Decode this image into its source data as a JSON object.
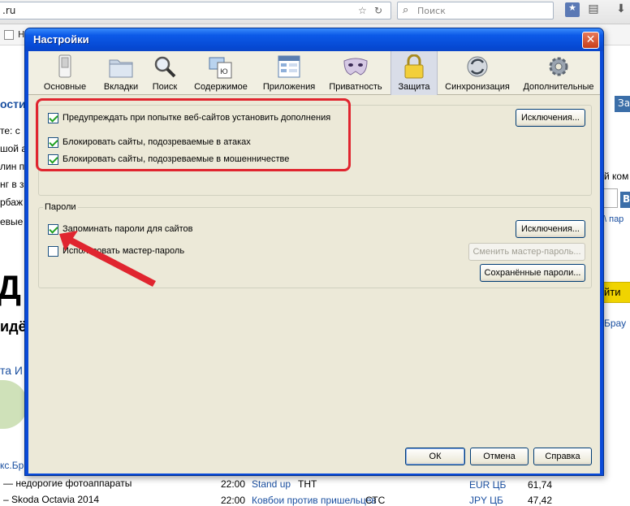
{
  "browser": {
    "url_fragment": ".ru",
    "search_placeholder": "Поиск",
    "bookmark_label": "Н"
  },
  "background_page": {
    "left_lines": [
      "ости",
      "те: с",
      "шой а",
      "лин п",
      "нг в з",
      "рбаж",
      "евые"
    ],
    "big_letter": "Д",
    "sub_text": "идёт",
    "link_text": "та И",
    "brand_link": "кс.Бр",
    "news_1": "— недорогие фотоаппараты",
    "news_2": "– Skoda Octavia 2014",
    "tv_time_1": "22:00",
    "tv_show_1": "Stand up",
    "tv_channel_1": "ТНТ",
    "tv_time_2": "22:00",
    "tv_show_2": "Ковбои против пришельцев",
    "tv_channel_2": "СТС",
    "currency_1": "EUR ЦБ",
    "rate_1": "61,74",
    "currency_2": "JPY ЦБ",
    "rate_2": "47,42",
    "right_tab": "За",
    "right_text_1": "й ком",
    "right_text_2": "\\ пар",
    "right_btn": "В",
    "right_find": "йти",
    "right_brau": "Брау"
  },
  "dialog": {
    "title": "Настройки",
    "categories": [
      {
        "label": "Основные",
        "icon": "switch-icon"
      },
      {
        "label": "Вкладки",
        "icon": "folder-tabs-icon"
      },
      {
        "label": "Поиск",
        "icon": "magnifier-icon"
      },
      {
        "label": "Содержимое",
        "icon": "content-icon"
      },
      {
        "label": "Приложения",
        "icon": "applications-icon"
      },
      {
        "label": "Приватность",
        "icon": "mask-icon"
      },
      {
        "label": "Защита",
        "icon": "padlock-icon",
        "selected": true
      },
      {
        "label": "Синхронизация",
        "icon": "sync-icon"
      },
      {
        "label": "Дополнительные",
        "icon": "gear-icon"
      }
    ],
    "security": {
      "warn_addons": {
        "label": "Предупреждать при попытке веб-сайтов установить дополнения",
        "checked": true
      },
      "exceptions_1": "Исключения...",
      "block_attack": {
        "label": "Блокировать сайты, подозреваемые в атаках",
        "checked": true
      },
      "block_forgery": {
        "label": "Блокировать сайты, подозреваемые в мошенничестве",
        "checked": true
      }
    },
    "passwords": {
      "group_title": "Пароли",
      "remember": {
        "label": "Запоминать пароли для сайтов",
        "checked": true
      },
      "exceptions_2": "Исключения...",
      "master": {
        "label": "Использовать мастер-пароль",
        "checked": false
      },
      "change_master": "Сменить мастер-пароль...",
      "saved_passwords": "Сохранённые пароли..."
    },
    "buttons": {
      "ok": "ОК",
      "cancel": "Отмена",
      "help": "Справка"
    }
  },
  "colors": {
    "annotation": "#e0252f",
    "accent_blue": "#0a4ad8"
  }
}
